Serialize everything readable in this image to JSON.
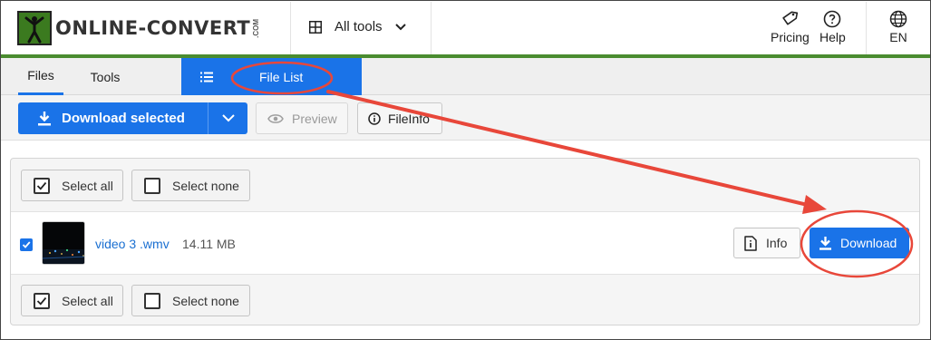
{
  "brand": {
    "logo_text": "ONLINE-CONVERT",
    "logo_suffix": ".COM"
  },
  "header": {
    "all_tools_label": "All tools",
    "pricing_label": "Pricing",
    "help_label": "Help",
    "language_label": "EN"
  },
  "tabs": {
    "files_label": "Files",
    "tools_label": "Tools",
    "file_list_label": "File List"
  },
  "toolbar": {
    "download_selected_label": "Download selected",
    "preview_label": "Preview",
    "fileinfo_label": "FileInfo"
  },
  "selection": {
    "select_all_label": "Select all",
    "select_none_label": "Select none"
  },
  "files": [
    {
      "name": "video 3 .wmv",
      "size": "14.11 MB",
      "checked": true,
      "info_label": "Info",
      "download_label": "Download"
    }
  ],
  "colors": {
    "accent": "#1a73e8",
    "brand_green": "#4a8c2f",
    "annotation_red": "#e8473a"
  },
  "icons": {
    "grid": "grid-icon",
    "chevron": "chevron-down-icon",
    "tag": "tag-icon",
    "help": "help-circle-icon",
    "globe": "globe-icon",
    "list": "list-icon",
    "download": "download-icon",
    "eye": "eye-icon",
    "info": "info-icon",
    "file_info": "file-info-icon"
  }
}
